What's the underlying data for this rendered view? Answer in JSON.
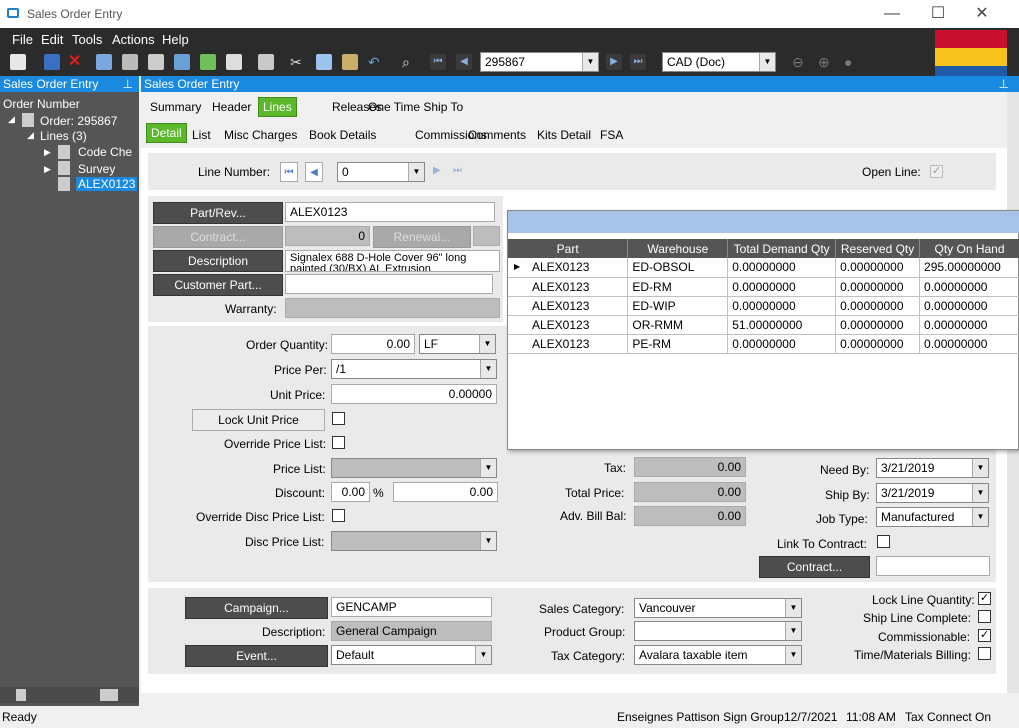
{
  "window": {
    "title": "Sales Order Entry"
  },
  "menu": [
    "File",
    "Edit",
    "Tools",
    "Actions",
    "Help"
  ],
  "toolbar": {
    "order_value": "295867",
    "currency": "CAD (Doc)"
  },
  "tree": {
    "header": "Sales Order Entry",
    "root": "Order Number",
    "order": "Order: 295867",
    "lines": "Lines (3)",
    "items": [
      "Code Che",
      "Survey",
      "ALEX0123"
    ]
  },
  "main_header": "Sales Order Entry",
  "tabs1": [
    "Summary",
    "Header",
    "Lines",
    "Releases",
    "One Time Ship To"
  ],
  "tabs2": [
    "Detail",
    "List",
    "Misc Charges",
    "Book Details",
    "Commissions",
    "Comments",
    "Kits Detail",
    "FSA"
  ],
  "line": {
    "label": "Line Number:",
    "value": "0",
    "open_line_label": "Open Line:",
    "open_line": "✓"
  },
  "part": {
    "btn": "Part/Rev...",
    "value": "ALEX0123",
    "contract_btn": "Contract...",
    "contract_val": "0",
    "renewal_btn": "Renewal...",
    "desc_btn": "Description",
    "desc_val": "Signalex 688 D-Hole Cover 96\" long painted (30/BX) AL Extrusion",
    "cust_btn": "Customer Part...",
    "warranty_label": "Warranty:"
  },
  "pricing": {
    "order_qty_label": "Order Quantity:",
    "order_qty": "0.00",
    "uom": "LF",
    "price_per_label": "Price Per:",
    "price_per": "/1",
    "unit_price_label": "Unit Price:",
    "unit_price": "0.00000",
    "lock_btn": "Lock Unit Price",
    "override_label": "Override Price List:",
    "price_list_label": "Price List:",
    "discount_label": "Discount:",
    "discount_pct": "0.00",
    "pct": "%",
    "discount_amt": "0.00",
    "override_disc_label": "Override Disc Price List:",
    "disc_list_label": "Disc Price List:"
  },
  "totals": {
    "tax_label": "Tax:",
    "tax": "0.00",
    "total_label": "Total Price:",
    "total": "0.00",
    "adv_label": "Adv. Bill Bal:",
    "adv": "0.00"
  },
  "dates": {
    "need_label": "Need By:",
    "need": "3/21/2019",
    "ship_label": "Ship By:",
    "ship": "3/21/2019",
    "job_label": "Job Type:",
    "job": "Manufactured",
    "link_label": "Link To Contract:",
    "contract_btn": "Contract..."
  },
  "bottom": {
    "campaign_btn": "Campaign...",
    "campaign": "GENCAMP",
    "desc_label": "Description:",
    "desc": "General Campaign",
    "event_btn": "Event...",
    "event": "Default",
    "sales_cat_label": "Sales Category:",
    "sales_cat": "Vancouver",
    "prod_grp_label": "Product Group:",
    "tax_cat_label": "Tax Category:",
    "tax_cat": "Avalara taxable item",
    "lock_qty_label": "Lock Line Quantity:",
    "ship_complete_label": "Ship Line Complete:",
    "commissionable_label": "Commissionable:",
    "tm_label": "Time/Materials Billing:"
  },
  "popup": {
    "columns": [
      "Part",
      "Warehouse",
      "Total Demand Qty",
      "Reserved Qty",
      "Qty On Hand"
    ],
    "rows": [
      [
        "ALEX0123",
        "ED-OBSOL",
        "0.00000000",
        "0.00000000",
        "295.00000000"
      ],
      [
        "ALEX0123",
        "ED-RM",
        "0.00000000",
        "0.00000000",
        "0.00000000"
      ],
      [
        "ALEX0123",
        "ED-WIP",
        "0.00000000",
        "0.00000000",
        "0.00000000"
      ],
      [
        "ALEX0123",
        "OR-RMM",
        "51.00000000",
        "0.00000000",
        "0.00000000"
      ],
      [
        "ALEX0123",
        "PE-RM",
        "0.00000000",
        "0.00000000",
        "0.00000000"
      ]
    ]
  },
  "status": {
    "ready": "Ready",
    "company": "Enseignes Pattison Sign Group",
    "date": "12/7/2021",
    "time": "11:08 AM",
    "tax": "Tax Connect On"
  }
}
